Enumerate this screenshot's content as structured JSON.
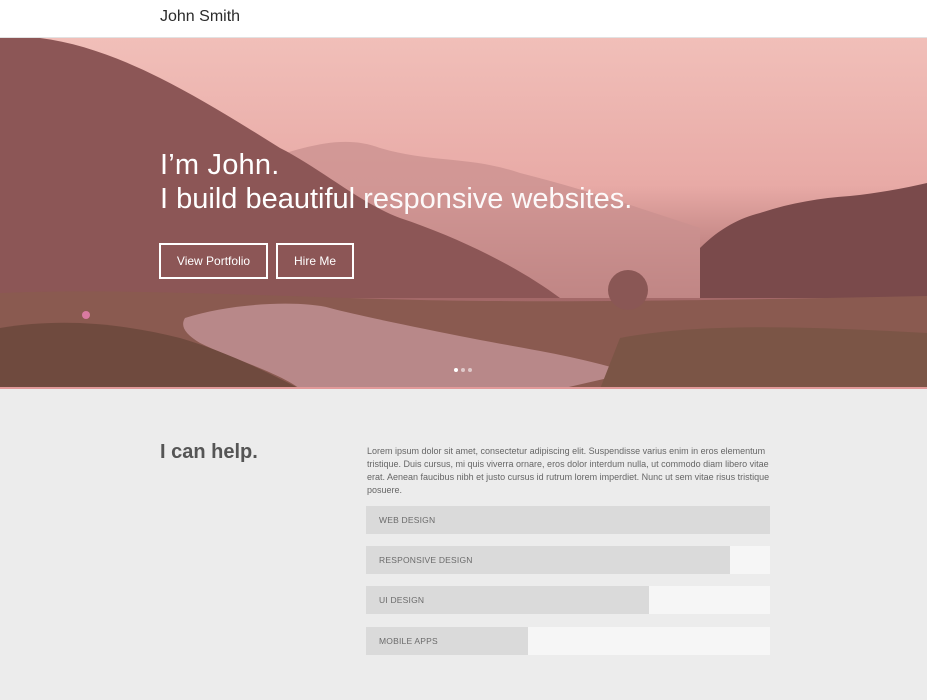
{
  "header": {
    "brand": "John Smith"
  },
  "hero": {
    "line1": "I’m John.",
    "line2_a": "I build beautiful",
    "line2_b": "responsive websites.",
    "buttons": {
      "portfolio": "View Portfolio",
      "hire": "Hire Me"
    },
    "carousel": {
      "slide_count": 3,
      "active_index": 0
    }
  },
  "help": {
    "title": "I can help.",
    "text": "Lorem ipsum dolor sit amet, consectetur adipiscing elit. Suspendisse varius enim in eros elementum tristique. Duis cursus, mi quis viverra ornare, eros dolor interdum nulla, ut commodo diam libero vitae erat. Aenean faucibus nibh et justo cursus id rutrum lorem imperdiet. Nunc ut sem vitae risus tristique posuere.",
    "skills": [
      {
        "label": "WEB DESIGN",
        "level": 1.0
      },
      {
        "label": "RESPONSIVE DESIGN",
        "level": 0.9
      },
      {
        "label": "UI DESIGN",
        "level": 0.7
      },
      {
        "label": "MOBILE APPS",
        "level": 0.4
      }
    ]
  },
  "colors": {
    "hero_overlay": "#e8aaa6",
    "bar_fill": "#dadada",
    "bar_track": "#f6f6f6",
    "section_bg": "#ececec"
  }
}
